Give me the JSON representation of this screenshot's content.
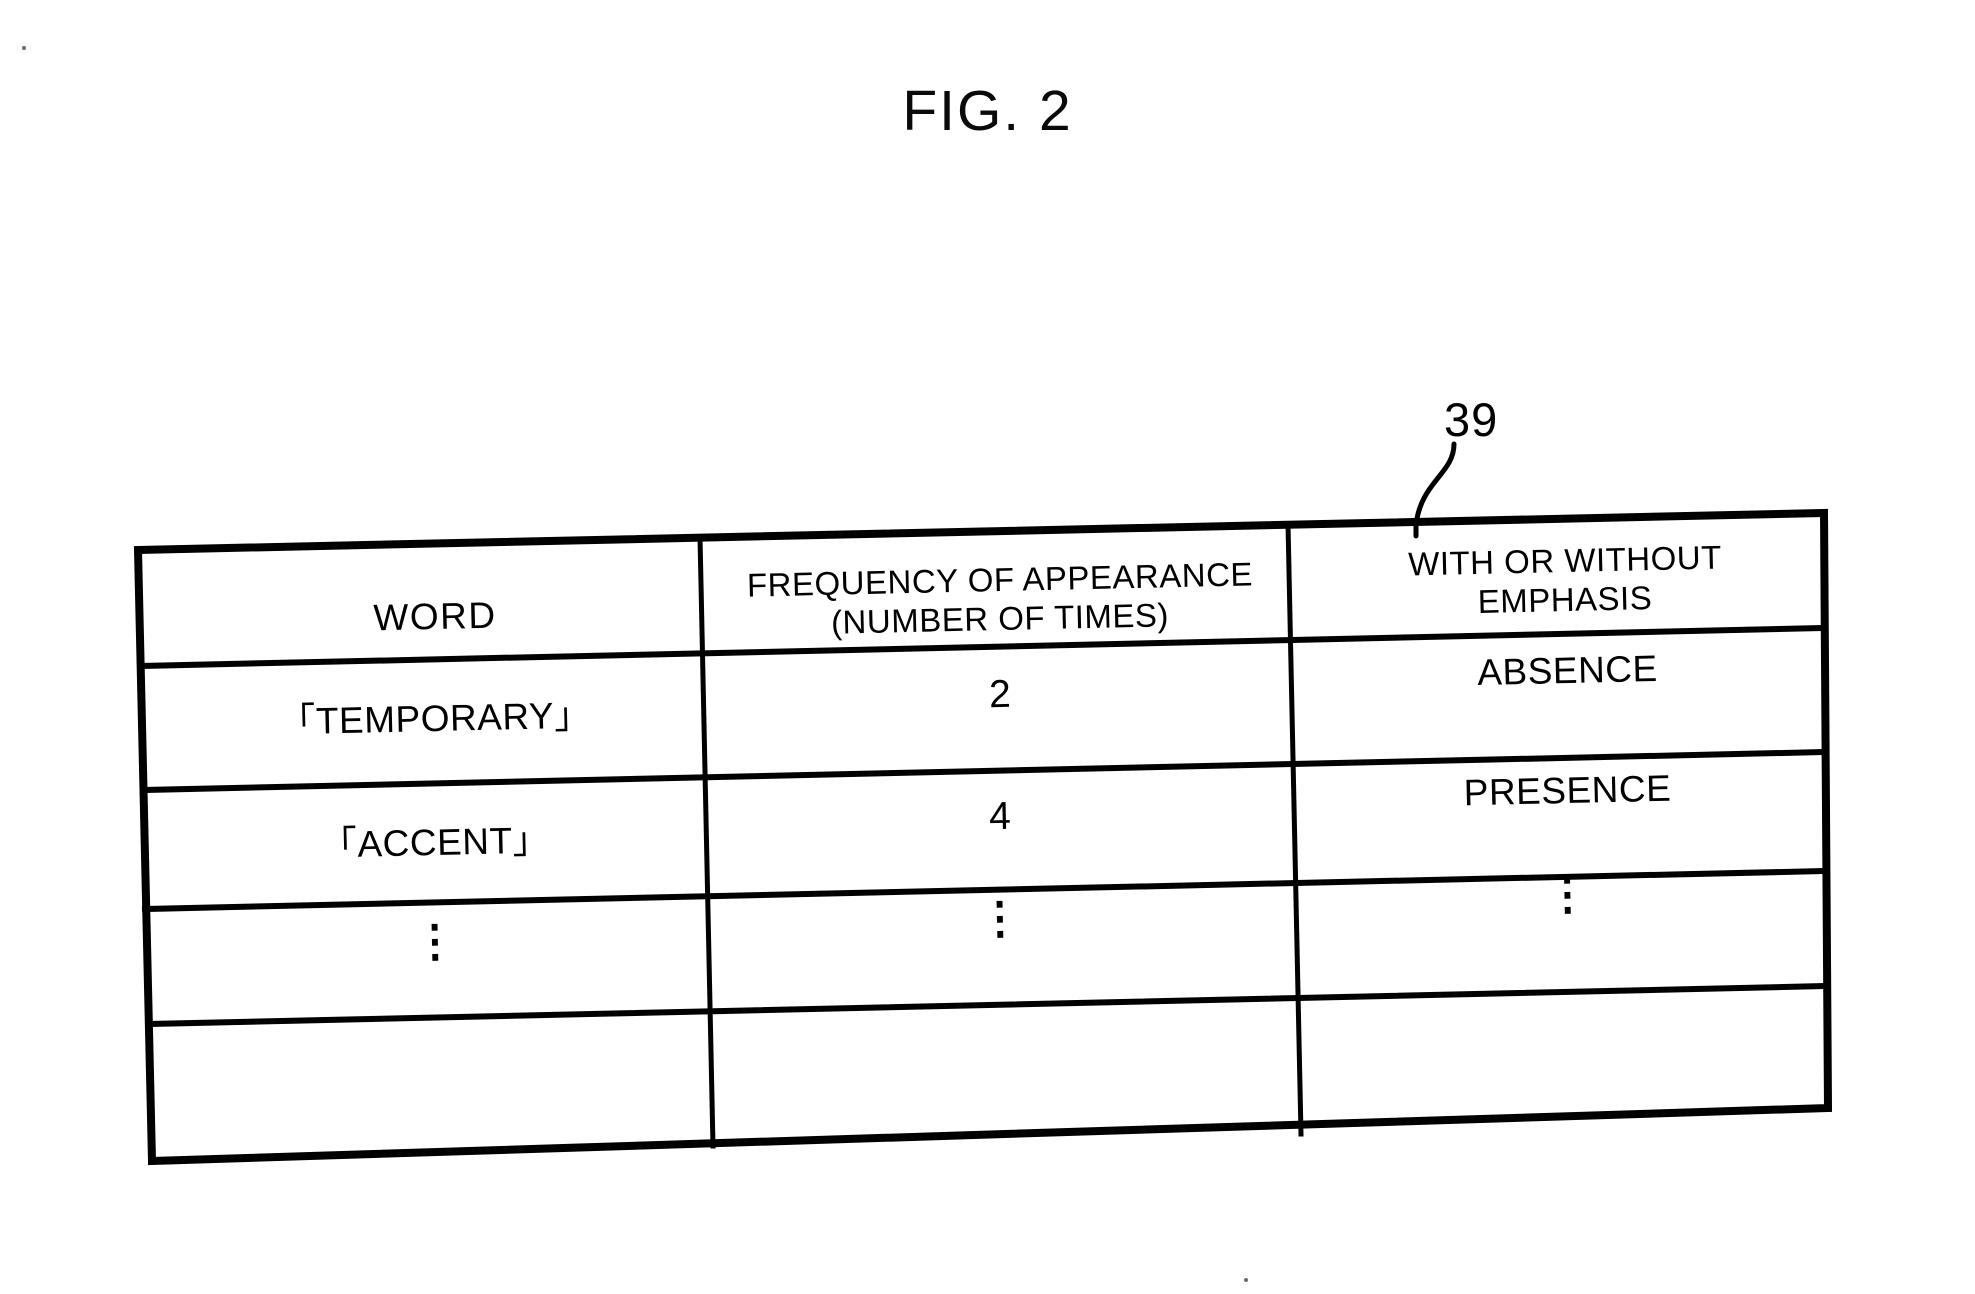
{
  "figure": {
    "title": "FIG. 2",
    "reference_numeral": "39"
  },
  "table": {
    "columns": [
      {
        "id": "word",
        "header": "WORD"
      },
      {
        "id": "frequency",
        "header_line1": "FREQUENCY OF APPEARANCE",
        "header_line2": "(NUMBER OF TIMES)"
      },
      {
        "id": "emphasis",
        "header_line1": "WITH OR WITHOUT",
        "header_line2": "EMPHASIS"
      }
    ],
    "rows": [
      {
        "word": "「TEMPORARY」",
        "frequency": "2",
        "emphasis": "ABSENCE"
      },
      {
        "word": "「ACCENT」",
        "frequency": "4",
        "emphasis": "PRESENCE"
      },
      {
        "word": "⋮",
        "frequency": "⋮",
        "emphasis": "⋮"
      },
      {
        "word": "",
        "frequency": "",
        "emphasis": ""
      }
    ]
  },
  "style": {
    "ink": "#000000",
    "paper": "#ffffff"
  }
}
